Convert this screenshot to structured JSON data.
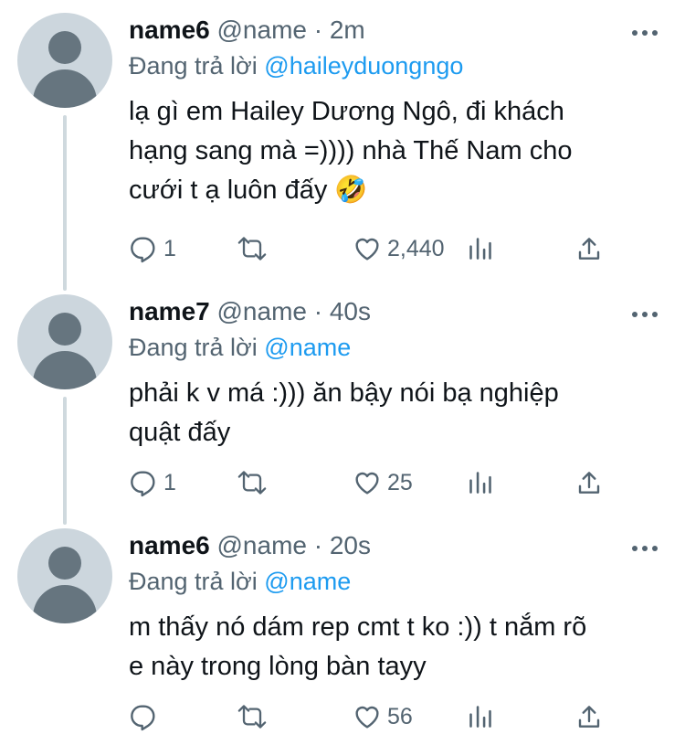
{
  "replying_prefix": "Đang trả lời",
  "icons": {
    "reply": "reply-icon",
    "retweet": "retweet-icon",
    "like": "heart-icon",
    "views": "analytics-icon",
    "share": "share-icon",
    "more": "more-icon",
    "avatar": "default-avatar-icon"
  },
  "colors": {
    "accent": "#1d9bf0",
    "muted": "#536471",
    "text": "#0f1419",
    "avatar_bg": "#ccd6dd",
    "avatar_fg": "#66757f",
    "thread_line": "#cfd9de"
  },
  "tweets": [
    {
      "display_name": "name6",
      "handle": "@name",
      "separator": "·",
      "time": "2m",
      "reply_to": "@haileyduongngo",
      "text_lines": [
        "lạ gì em Hailey Dương Ngô, đi khách",
        "hạng sang mà =)))) nhà Thế Nam cho",
        "cưới t ạ luôn đấy 🤣"
      ],
      "reply_count": "1",
      "like_count": "2,440"
    },
    {
      "display_name": "name7",
      "handle": "@name",
      "separator": "·",
      "time": "40s",
      "reply_to": "@name",
      "text_lines": [
        "phải k v má :))) ăn bậy nói bạ nghiệp",
        "quật đấy"
      ],
      "reply_count": "1",
      "like_count": "25"
    },
    {
      "display_name": "name6",
      "handle": "@name",
      "separator": "·",
      "time": "20s",
      "reply_to": "@name",
      "text_lines": [
        "m thấy nó dám rep cmt t ko :)) t nắm rõ",
        "e này trong lòng bàn tayy"
      ],
      "reply_count": "",
      "like_count": "56"
    }
  ]
}
